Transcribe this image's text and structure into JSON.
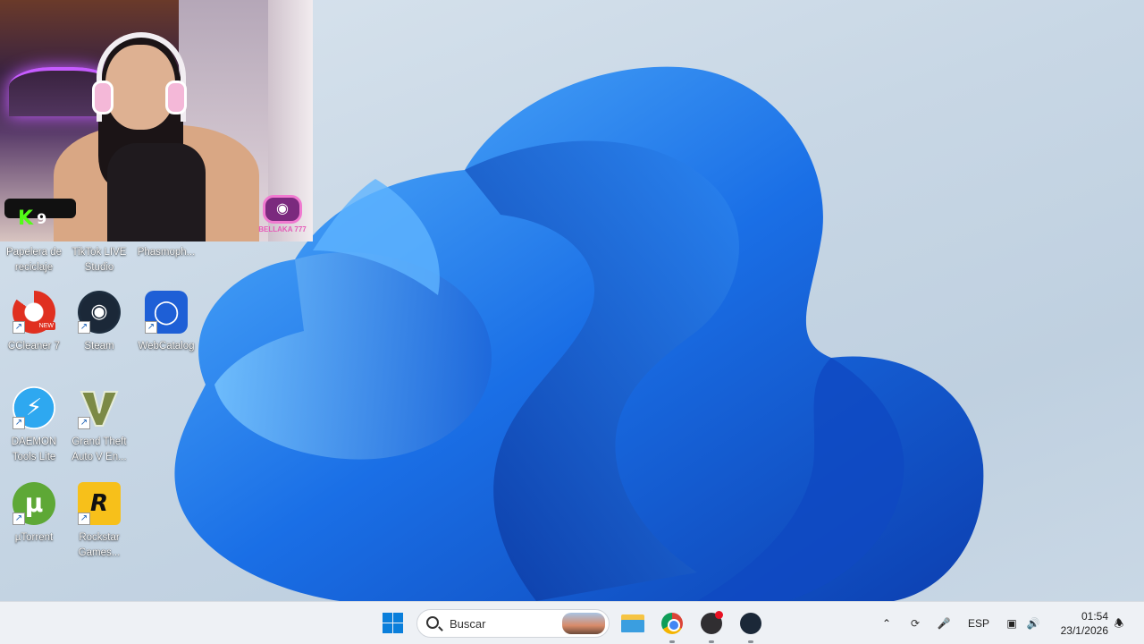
{
  "webcam": {
    "kick_letter": "K",
    "kick_count": "9",
    "channel_name": "BELLAKA 777"
  },
  "desktop": {
    "icons": [
      {
        "label": "Papelera de reciclaje",
        "icon": "recycle-bin-icon"
      },
      {
        "label": "TikTok LIVE Studio",
        "icon": "tiktok-live-icon"
      },
      {
        "label": "Phasmoph...",
        "icon": "phasmophobia-icon"
      },
      {
        "label": "CCleaner 7",
        "icon": "ccleaner-icon",
        "badge": "NEW"
      },
      {
        "label": "Steam",
        "icon": "steam-icon"
      },
      {
        "label": "WebCatalog",
        "icon": "webcatalog-icon"
      },
      {
        "label": "DAEMON Tools Lite",
        "icon": "daemon-tools-icon"
      },
      {
        "label": "Grand Theft Auto V En...",
        "icon": "gta-v-icon"
      },
      {
        "label": "µTorrent",
        "icon": "utorrent-icon"
      },
      {
        "label": "Rockstar Games...",
        "icon": "rockstar-icon"
      }
    ]
  },
  "taskbar": {
    "search_placeholder": "Buscar",
    "apps": [
      "file-explorer-icon",
      "chrome-icon",
      "obs-icon",
      "steam-icon"
    ],
    "tray": {
      "language": "ESP"
    },
    "clock": {
      "time": "01:54",
      "date": "23/1/2026"
    }
  },
  "colors": {
    "accent": "#0a7fdb",
    "bloom": "#1a6fe6",
    "kick_green": "#53fc18"
  }
}
